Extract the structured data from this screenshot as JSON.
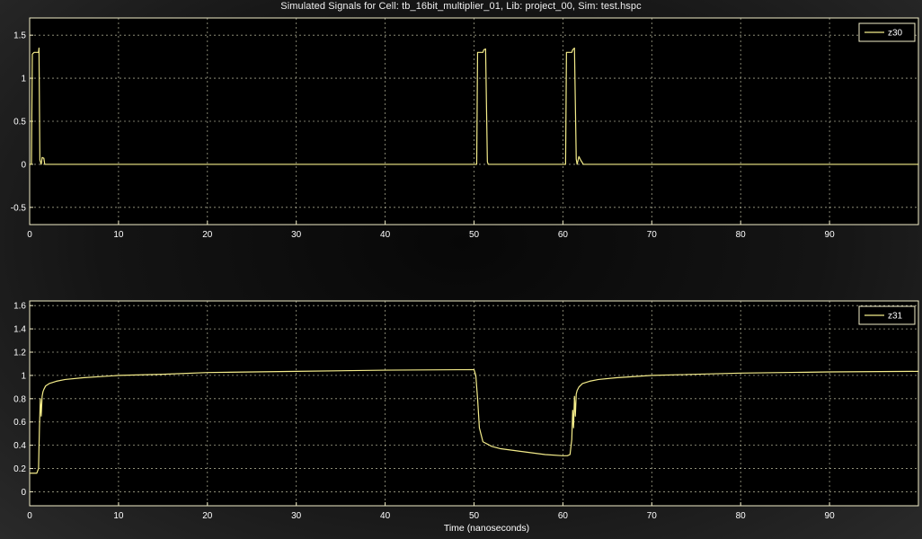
{
  "window": {
    "title": "Simulated Signals for Cell: tb_16bit_multiplier_01, Lib: project_00, Sim: test.hspc"
  },
  "colors": {
    "background": "#0a0a0a",
    "axes_frame": "#f2eec8",
    "grid": "#d8d8b8",
    "trace": "#f4ec8a",
    "text": "#ffffff"
  },
  "chart_data": [
    {
      "type": "line",
      "xlabel": "",
      "ylabel": "",
      "xlim": [
        0,
        100
      ],
      "ylim": [
        -0.7,
        1.7
      ],
      "xticks": [
        0,
        10,
        20,
        30,
        40,
        50,
        60,
        70,
        80,
        90
      ],
      "yticks": [
        -0.5,
        0,
        0.5,
        1,
        1.5
      ],
      "ytick_labels": [
        "-0.5",
        "0",
        "0.5",
        "1",
        "1.5"
      ],
      "grid": true,
      "legend_position": "top-right",
      "series": [
        {
          "name": "z30",
          "x": [
            0,
            0.2,
            0.3,
            0.5,
            1.0,
            1.05,
            1.15,
            1.3,
            1.4,
            1.6,
            1.7,
            10,
            20,
            30,
            40,
            50,
            50.3,
            50.4,
            51.0,
            51.1,
            51.3,
            51.5,
            51.6,
            60,
            60.3,
            60.4,
            61.0,
            61.1,
            61.3,
            61.5,
            61.6,
            61.8,
            62.0,
            62.3,
            70,
            80,
            90,
            100
          ],
          "y": [
            0,
            0,
            1.28,
            1.3,
            1.3,
            1.35,
            0.05,
            0,
            0.08,
            0.07,
            0,
            0,
            0,
            0,
            0,
            0,
            0,
            1.3,
            1.3,
            1.33,
            1.34,
            0.03,
            0,
            0,
            0,
            1.3,
            1.3,
            1.33,
            1.35,
            0.06,
            0,
            0.09,
            0.05,
            0,
            0,
            0,
            0,
            0
          ]
        }
      ]
    },
    {
      "type": "line",
      "xlabel": "Time (nanoseconds)",
      "ylabel": "",
      "xlim": [
        0,
        100
      ],
      "ylim": [
        -0.12,
        1.64
      ],
      "xticks": [
        0,
        10,
        20,
        30,
        40,
        50,
        60,
        70,
        80,
        90
      ],
      "yticks": [
        0,
        0.2,
        0.4,
        0.6,
        0.8,
        1,
        1.2,
        1.4,
        1.6
      ],
      "ytick_labels": [
        "0",
        "0.2",
        "0.4",
        "0.6",
        "0.8",
        "1",
        "1.2",
        "1.4",
        "1.6"
      ],
      "grid": true,
      "legend_position": "top-right",
      "series": [
        {
          "name": "z31",
          "x": [
            0,
            0.8,
            1.0,
            1.1,
            1.2,
            1.3,
            1.4,
            1.5,
            1.6,
            1.8,
            2.2,
            3,
            4,
            6,
            8,
            10,
            15,
            20,
            30,
            40,
            50,
            50.2,
            50.4,
            50.6,
            51,
            52,
            53,
            55,
            58,
            60,
            60.5,
            60.8,
            61.0,
            61.1,
            61.2,
            61.3,
            61.4,
            61.5,
            61.6,
            61.8,
            62.2,
            63,
            64,
            66,
            70,
            80,
            90,
            100
          ],
          "y": [
            0.16,
            0.16,
            0.2,
            0.55,
            0.8,
            0.65,
            0.82,
            0.86,
            0.88,
            0.91,
            0.93,
            0.95,
            0.965,
            0.98,
            0.99,
            1.0,
            1.01,
            1.025,
            1.035,
            1.045,
            1.05,
            1.0,
            0.8,
            0.55,
            0.43,
            0.39,
            0.37,
            0.35,
            0.32,
            0.31,
            0.31,
            0.32,
            0.45,
            0.7,
            0.55,
            0.82,
            0.65,
            0.84,
            0.87,
            0.9,
            0.93,
            0.95,
            0.965,
            0.98,
            1.0,
            1.02,
            1.03,
            1.035
          ]
        }
      ]
    }
  ]
}
